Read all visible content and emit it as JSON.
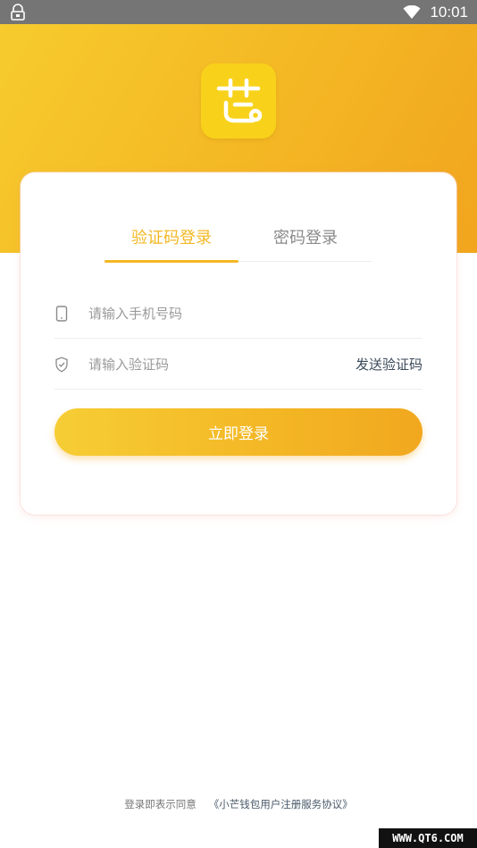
{
  "status_bar": {
    "time": "10:01"
  },
  "login": {
    "tabs": [
      {
        "label": "验证码登录",
        "active": true
      },
      {
        "label": "密码登录",
        "active": false
      }
    ],
    "phone_field": {
      "placeholder": "请输入手机号码",
      "value": ""
    },
    "code_field": {
      "placeholder": "请输入验证码",
      "value": ""
    },
    "send_code_label": "发送验证码",
    "submit_label": "立即登录"
  },
  "footer": {
    "agreement_prefix": "登录即表示同意",
    "agreement_link": "《小芒钱包用户注册服务协议》"
  },
  "watermark": "WWW.QT6.COM",
  "icons": {
    "status_left": "bag-icon",
    "wifi": "wifi-icon",
    "logo": "app-logo-icon",
    "phone": "phone-icon",
    "code": "shield-check-icon"
  },
  "colors": {
    "accent": "#f3b824",
    "header_gradient_start": "#f6cb2d",
    "header_gradient_end": "#f1a51e",
    "status_bar": "#757575"
  }
}
